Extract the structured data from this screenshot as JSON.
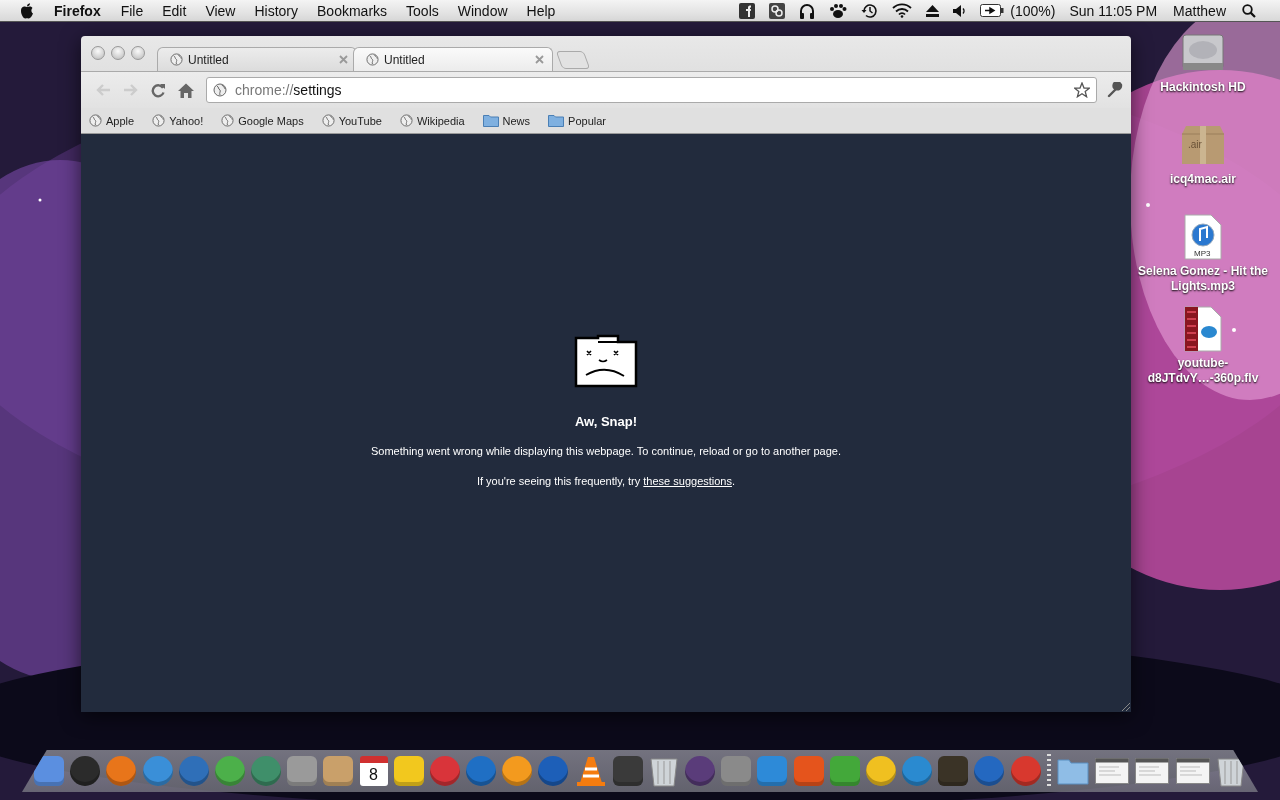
{
  "menu_bar": {
    "app": "Firefox",
    "menus": [
      "File",
      "Edit",
      "View",
      "History",
      "Bookmarks",
      "Tools",
      "Window",
      "Help"
    ],
    "battery": "(100%)",
    "clock": "Sun 11:05 PM",
    "user": "Matthew"
  },
  "browser": {
    "tabs": [
      {
        "title": "Untitled",
        "selected": false
      },
      {
        "title": "Untitled",
        "selected": true
      }
    ],
    "back": {
      "disabled": true
    },
    "forward": {
      "disabled": true
    },
    "address": {
      "scheme": "chrome://",
      "path": "settings"
    },
    "bookmarks": [
      {
        "label": "Apple",
        "kind": "page"
      },
      {
        "label": "Yahoo!",
        "kind": "page"
      },
      {
        "label": "Google Maps",
        "kind": "page"
      },
      {
        "label": "YouTube",
        "kind": "page"
      },
      {
        "label": "Wikipedia",
        "kind": "page"
      },
      {
        "label": "News",
        "kind": "folder"
      },
      {
        "label": "Popular",
        "kind": "folder"
      }
    ],
    "page": {
      "title": "Aw, Snap!",
      "message": "Something went wrong while displaying this webpage. To continue, reload or go to another page.",
      "hint": "If you're seeing this frequently, try ",
      "link": "these suggestions",
      "hint_end": "."
    }
  },
  "desktop_icons": [
    {
      "label": "Hackintosh HD",
      "kind": "disk"
    },
    {
      "label": "icq4mac.air",
      "kind": "package",
      "badge": ".air"
    },
    {
      "label": "Selena Gomez - Hit the Lights.mp3",
      "kind": "audio",
      "badge": "MP3"
    },
    {
      "label": "youtube-d8JTdvY…-360p.flv",
      "kind": "video"
    }
  ],
  "dock": [
    {
      "kind": "tile",
      "color": "#5b8fe0"
    },
    {
      "kind": "circle",
      "color": "#2b2b2b"
    },
    {
      "kind": "circle",
      "color": "#e8751a"
    },
    {
      "kind": "circle",
      "color": "#3a8fd8"
    },
    {
      "kind": "circle",
      "color": "#2f6fb8"
    },
    {
      "kind": "circle",
      "color": "#4cb04a"
    },
    {
      "kind": "circle",
      "color": "#3f8f6a"
    },
    {
      "kind": "tile",
      "color": "#9a9a9a"
    },
    {
      "kind": "tile",
      "color": "#c9a06a"
    },
    {
      "kind": "calendar",
      "text": "8"
    },
    {
      "kind": "tile",
      "color": "#f2c81e"
    },
    {
      "kind": "circle",
      "color": "#d9343a"
    },
    {
      "kind": "circle",
      "color": "#1f6fc4"
    },
    {
      "kind": "circle",
      "color": "#f39a1e"
    },
    {
      "kind": "circle",
      "color": "#1d5fb8"
    },
    {
      "kind": "cone",
      "color": "#f57c0f"
    },
    {
      "kind": "tile",
      "color": "#3a3a3a"
    },
    {
      "kind": "trash"
    },
    {
      "kind": "circle",
      "color": "#5a3c7a"
    },
    {
      "kind": "tile",
      "color": "#8a8a8a"
    },
    {
      "kind": "tile",
      "color": "#2d8ad8"
    },
    {
      "kind": "tile",
      "color": "#e5541c"
    },
    {
      "kind": "tile",
      "color": "#43a83a"
    },
    {
      "kind": "circle",
      "color": "#f0c020"
    },
    {
      "kind": "circle",
      "color": "#2a8ad0"
    },
    {
      "kind": "tile",
      "color": "#3a3326"
    },
    {
      "kind": "circle",
      "color": "#2468c0"
    },
    {
      "kind": "circle",
      "color": "#d8382e"
    },
    {
      "kind": "separator"
    },
    {
      "kind": "folder"
    },
    {
      "kind": "window"
    },
    {
      "kind": "window"
    },
    {
      "kind": "window"
    },
    {
      "kind": "trash"
    }
  ]
}
